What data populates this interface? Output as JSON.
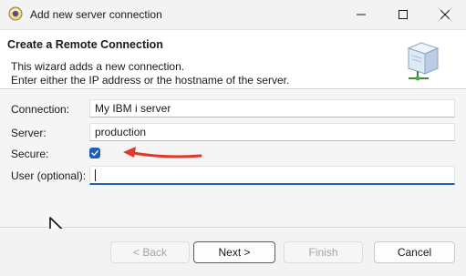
{
  "window": {
    "title": "Add new server connection",
    "app_icon": "eclipse-app-icon"
  },
  "banner": {
    "title": "Create a Remote Connection",
    "description_lines": [
      "This wizard adds a new connection.",
      "Enter either the IP address or the hostname of the server."
    ],
    "icon": "server-icon"
  },
  "form": {
    "connection": {
      "label": "Connection:",
      "value": "My IBM i server"
    },
    "server": {
      "label": "Server:",
      "value": "production"
    },
    "secure": {
      "label": "Secure:",
      "checked": true
    },
    "user": {
      "label": "User (optional):",
      "value": ""
    }
  },
  "annotation": {
    "icon": "red-arrow-icon",
    "color": "#e0392b"
  },
  "buttons": {
    "back": "< Back",
    "next": "Next >",
    "finish": "Finish",
    "cancel": "Cancel"
  },
  "colors": {
    "accent": "#1f5db8",
    "title_bar": "#f3f3f3",
    "form_background": "#f5f5f5"
  }
}
